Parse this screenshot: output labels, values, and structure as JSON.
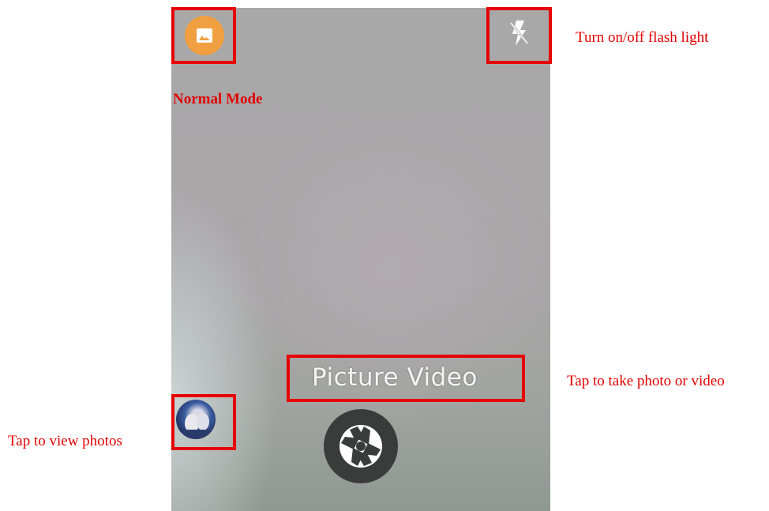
{
  "annotations": {
    "normal_mode": "Normal Mode",
    "flash": "Turn on/off flash light",
    "take_photo": "Tap to take photo or video",
    "view_photos": "Tap to view photos"
  },
  "camera": {
    "mode_options": "Picture Video",
    "mode_icon": "image-icon",
    "flash_icon": "flash-off-icon",
    "shutter_icon": "aperture-icon",
    "thumbnail_icon": "gallery-thumbnail"
  },
  "colors": {
    "highlight": "#e60000",
    "annotation_text": "#e00000",
    "mode_icon_bg": "#f0a040",
    "shutter_bg": "#3a3c3c"
  }
}
